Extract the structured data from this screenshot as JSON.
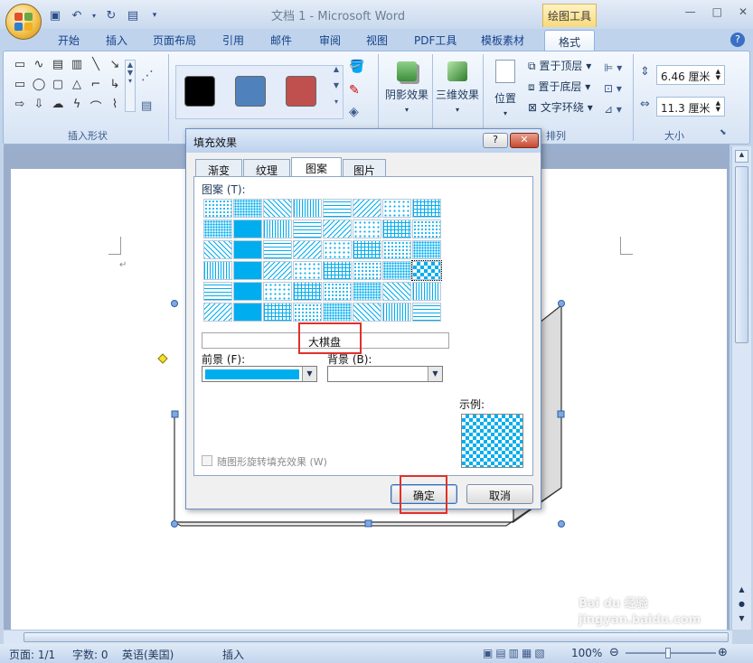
{
  "window": {
    "title": "文档 1 - Microsoft Word",
    "context_tab_group": "绘图工具"
  },
  "ribbon_tabs": [
    "开始",
    "插入",
    "页面布局",
    "引用",
    "邮件",
    "审阅",
    "视图",
    "PDF工具",
    "模板素材",
    "格式"
  ],
  "active_tab": "格式",
  "ribbon": {
    "insert_shapes_label": "插入形状",
    "shadow_effect_label": "阴影效果",
    "threed_effect_label": "三维效果",
    "position_label": "位置",
    "bring_to_front_label": "置于顶层",
    "send_to_back_label": "置于底层",
    "text_wrap_label": "文字环绕",
    "arrange_label": "排列",
    "size_label": "大小",
    "height_value": "6.46 厘米",
    "width_value": "11.3 厘米",
    "style_colors": [
      "#000000",
      "#4f81bd",
      "#c0504d"
    ]
  },
  "dialog": {
    "title": "填充效果",
    "help_label": "?",
    "close_label": "✕",
    "tabs": [
      "渐变",
      "纹理",
      "图案",
      "图片"
    ],
    "active_tab": "图案",
    "pattern_label": "图案 (T):",
    "pattern_name": "大棋盘",
    "foreground_label": "前景 (F):",
    "background_label": "背景 (B):",
    "foreground_color": "#00aeef",
    "background_color": "#ffffff",
    "sample_label": "示例:",
    "rotate_label": "随图形旋转填充效果 (W)",
    "ok_label": "确定",
    "cancel_label": "取消",
    "selected_pattern_index": 31
  },
  "status": {
    "page": "页面: 1/1",
    "words": "字数: 0",
    "language": "英语(美国)",
    "mode": "插入",
    "zoom": "100%"
  },
  "watermark": "Bai du 经验 jingyan.baidu.com"
}
